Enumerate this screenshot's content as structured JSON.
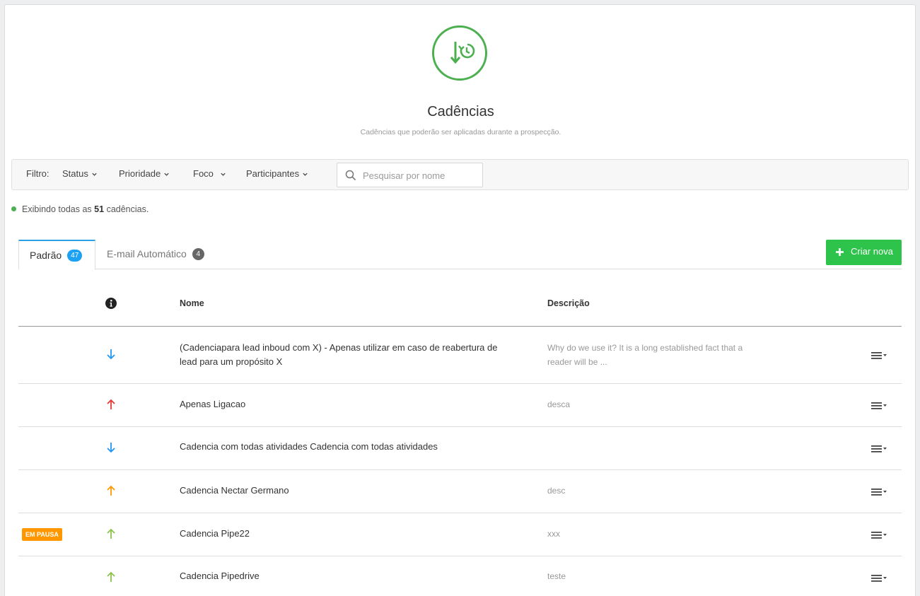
{
  "page": {
    "title": "Cadências",
    "subtitle": "Cadências que poderão ser aplicadas durante a prospecção."
  },
  "filters": {
    "label": "Filtro:",
    "status": "Status",
    "prioridade": "Prioridade",
    "foco": "Foco",
    "participantes": "Participantes",
    "search_placeholder": "Pesquisar por nome"
  },
  "summary": {
    "prefix": "Exibindo todas as",
    "count": "51",
    "suffix": "cadências."
  },
  "tabs": [
    {
      "label": "Padrão",
      "count": "47"
    },
    {
      "label": "E-mail Automático",
      "count": "4"
    }
  ],
  "actions": {
    "new_label": "Criar nova"
  },
  "table": {
    "columns": {
      "name": "Nome",
      "description": "Descrição"
    },
    "rows": [
      {
        "status": "",
        "priority": "down",
        "name": "(Cadenciapara lead inboud com X) - Apenas utilizar em caso de reabertura de lead para um propósito X",
        "description": "Why do we use it? It is a long established fact that a reader will be ..."
      },
      {
        "status": "",
        "priority": "up-high",
        "name": "Apenas Ligacao",
        "description": "desca"
      },
      {
        "status": "",
        "priority": "down",
        "name": "Cadencia com todas atividades Cadencia com todas atividades",
        "description": ""
      },
      {
        "status": "",
        "priority": "up-medium",
        "name": "Cadencia Nectar Germano",
        "description": "desc"
      },
      {
        "status": "EM PAUSA",
        "priority": "up-low",
        "name": "Cadencia Pipe22",
        "description": "xxx"
      },
      {
        "status": "",
        "priority": "up-low",
        "name": "Cadencia Pipedrive",
        "description": "teste"
      }
    ]
  },
  "colors": {
    "accent_green": "#4caf50",
    "button_green": "#2ec34a",
    "tab_blue": "#2aa0e6",
    "arrow_down": "#2196f3",
    "arrow_up_high": "#e53935",
    "arrow_up_medium": "#ff9800",
    "arrow_up_low": "#8bc34a",
    "paused": "#ff9800"
  },
  "icons": {
    "hero": "cadence-clock-icon",
    "search": "search-icon",
    "info": "info-icon",
    "add": "plus-icon",
    "row_menu": "menu-caret-icon"
  }
}
